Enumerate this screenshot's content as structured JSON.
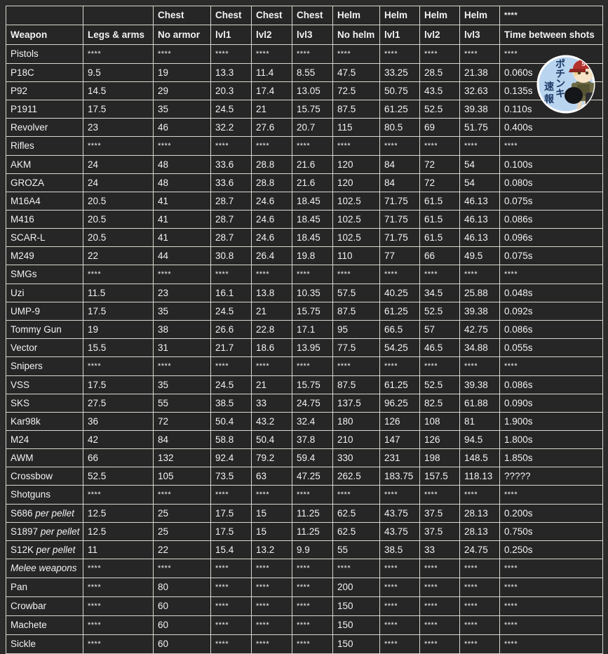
{
  "table": {
    "header_top": [
      "",
      "",
      "Chest",
      "Chest",
      "Chest",
      "Chest",
      "Helm",
      "Helm",
      "Helm",
      "Helm",
      "****"
    ],
    "header_main": [
      "Weapon",
      "Legs & arms",
      "No armor",
      "lvl1",
      "lvl2",
      "lvl3",
      "No helm",
      "lvl1",
      "lvl2",
      "lvl3",
      "Time between shots"
    ],
    "placeholder": "****",
    "rows": [
      {
        "type": "group",
        "style": "bold",
        "cells": [
          "Pistols",
          "****",
          "****",
          "****",
          "****",
          "****",
          "****",
          "****",
          "****",
          "****",
          "****"
        ]
      },
      {
        "type": "data",
        "cells": [
          "P18C",
          "9.5",
          "19",
          "13.3",
          "11.4",
          "8.55",
          "47.5",
          "33.25",
          "28.5",
          "21.38",
          "0.060s"
        ]
      },
      {
        "type": "data",
        "cells": [
          "P92",
          "14.5",
          "29",
          "20.3",
          "17.4",
          "13.05",
          "72.5",
          "50.75",
          "43.5",
          "32.63",
          "0.135s"
        ]
      },
      {
        "type": "data",
        "cells": [
          "P1911",
          "17.5",
          "35",
          "24.5",
          "21",
          "15.75",
          "87.5",
          "61.25",
          "52.5",
          "39.38",
          "0.110s"
        ]
      },
      {
        "type": "data",
        "cells": [
          "Revolver",
          "23",
          "46",
          "32.2",
          "27.6",
          "20.7",
          "115",
          "80.5",
          "69",
          "51.75",
          "0.400s"
        ]
      },
      {
        "type": "group",
        "style": "bold",
        "cells": [
          "Rifles",
          "****",
          "****",
          "****",
          "****",
          "****",
          "****",
          "****",
          "****",
          "****",
          "****"
        ]
      },
      {
        "type": "data",
        "cells": [
          "AKM",
          "24",
          "48",
          "33.6",
          "28.8",
          "21.6",
          "120",
          "84",
          "72",
          "54",
          "0.100s"
        ]
      },
      {
        "type": "data",
        "cells": [
          "GROZA",
          "24",
          "48",
          "33.6",
          "28.8",
          "21.6",
          "120",
          "84",
          "72",
          "54",
          "0.080s"
        ]
      },
      {
        "type": "data",
        "cells": [
          "M16A4",
          "20.5",
          "41",
          "28.7",
          "24.6",
          "18.45",
          "102.5",
          "71.75",
          "61.5",
          "46.13",
          "0.075s"
        ]
      },
      {
        "type": "data",
        "cells": [
          "M416",
          "20.5",
          "41",
          "28.7",
          "24.6",
          "18.45",
          "102.5",
          "71.75",
          "61.5",
          "46.13",
          "0.086s"
        ]
      },
      {
        "type": "data",
        "cells": [
          "SCAR-L",
          "20.5",
          "41",
          "28.7",
          "24.6",
          "18.45",
          "102.5",
          "71.75",
          "61.5",
          "46.13",
          "0.096s"
        ]
      },
      {
        "type": "data",
        "cells": [
          "M249",
          "22",
          "44",
          "30.8",
          "26.4",
          "19.8",
          "110",
          "77",
          "66",
          "49.5",
          "0.075s"
        ]
      },
      {
        "type": "group",
        "style": "bold",
        "cells": [
          "SMGs",
          "****",
          "****",
          "****",
          "****",
          "****",
          "****",
          "****",
          "****",
          "****",
          "****"
        ]
      },
      {
        "type": "data",
        "cells": [
          "Uzi",
          "11.5",
          "23",
          "16.1",
          "13.8",
          "10.35",
          "57.5",
          "40.25",
          "34.5",
          "25.88",
          "0.048s"
        ]
      },
      {
        "type": "data",
        "cells": [
          "UMP-9",
          "17.5",
          "35",
          "24.5",
          "21",
          "15.75",
          "87.5",
          "61.25",
          "52.5",
          "39.38",
          "0.092s"
        ]
      },
      {
        "type": "data",
        "cells": [
          "Tommy Gun",
          "19",
          "38",
          "26.6",
          "22.8",
          "17.1",
          "95",
          "66.5",
          "57",
          "42.75",
          "0.086s"
        ]
      },
      {
        "type": "data",
        "cells": [
          "Vector",
          "15.5",
          "31",
          "21.7",
          "18.6",
          "13.95",
          "77.5",
          "54.25",
          "46.5",
          "34.88",
          "0.055s"
        ]
      },
      {
        "type": "group",
        "style": "bold",
        "cells": [
          "Snipers",
          "****",
          "****",
          "****",
          "****",
          "****",
          "****",
          "****",
          "****",
          "****",
          "****"
        ]
      },
      {
        "type": "data",
        "cells": [
          "VSS",
          "17.5",
          "35",
          "24.5",
          "21",
          "15.75",
          "87.5",
          "61.25",
          "52.5",
          "39.38",
          "0.086s"
        ]
      },
      {
        "type": "data",
        "cells": [
          "SKS",
          "27.5",
          "55",
          "38.5",
          "33",
          "24.75",
          "137.5",
          "96.25",
          "82.5",
          "61.88",
          "0.090s"
        ]
      },
      {
        "type": "data",
        "cells": [
          "Kar98k",
          "36",
          "72",
          "50.4",
          "43.2",
          "32.4",
          "180",
          "126",
          "108",
          "81",
          "1.900s"
        ]
      },
      {
        "type": "data",
        "cells": [
          "M24",
          "42",
          "84",
          "58.8",
          "50.4",
          "37.8",
          "210",
          "147",
          "126",
          "94.5",
          "1.800s"
        ]
      },
      {
        "type": "data",
        "cells": [
          "AWM",
          "66",
          "132",
          "92.4",
          "79.2",
          "59.4",
          "330",
          "231",
          "198",
          "148.5",
          "1.850s"
        ]
      },
      {
        "type": "data",
        "cells": [
          "Crossbow",
          "52.5",
          "105",
          "73.5",
          "63",
          "47.25",
          "262.5",
          "183.75",
          "157.5",
          "118.13",
          "?????"
        ]
      },
      {
        "type": "group",
        "style": "bold",
        "cells": [
          "Shotguns",
          "****",
          "****",
          "****",
          "****",
          "****",
          "****",
          "****",
          "****",
          "****",
          "****"
        ]
      },
      {
        "type": "data",
        "name_main": "S686",
        "name_suffix": "per pellet",
        "cells": [
          "S686 per pellet",
          "12.5",
          "25",
          "17.5",
          "15",
          "11.25",
          "62.5",
          "43.75",
          "37.5",
          "28.13",
          "0.200s"
        ]
      },
      {
        "type": "data",
        "name_main": "S1897",
        "name_suffix": "per pellet",
        "cells": [
          "S1897 per pellet",
          "12.5",
          "25",
          "17.5",
          "15",
          "11.25",
          "62.5",
          "43.75",
          "37.5",
          "28.13",
          "0.750s"
        ]
      },
      {
        "type": "data",
        "name_main": "S12K",
        "name_suffix": "per pellet",
        "cells": [
          "S12K per pellet",
          "11",
          "22",
          "15.4",
          "13.2",
          "9.9",
          "55",
          "38.5",
          "33",
          "24.75",
          "0.250s"
        ]
      },
      {
        "type": "group",
        "style": "bold-italic",
        "cells": [
          "Melee weapons",
          "****",
          "****",
          "****",
          "****",
          "****",
          "****",
          "****",
          "****",
          "****",
          "****"
        ]
      },
      {
        "type": "data",
        "cells": [
          "Pan",
          "****",
          "80",
          "****",
          "****",
          "****",
          "200",
          "****",
          "****",
          "****",
          "****"
        ]
      },
      {
        "type": "data",
        "cells": [
          "Crowbar",
          "****",
          "60",
          "****",
          "****",
          "****",
          "150",
          "****",
          "****",
          "****",
          "****"
        ]
      },
      {
        "type": "data",
        "cells": [
          "Machete",
          "****",
          "60",
          "****",
          "****",
          "****",
          "150",
          "****",
          "****",
          "****",
          "****"
        ]
      },
      {
        "type": "data",
        "cells": [
          "Sickle",
          "****",
          "60",
          "****",
          "****",
          "****",
          "150",
          "****",
          "****",
          "****",
          "****"
        ]
      }
    ]
  },
  "watermark": {
    "name": "pochinki-sokuhou-logo",
    "text_vertical_right": "ポチンキ",
    "text_vertical_left": "速報",
    "cap_letter": "S",
    "circle_color": "#b9d4ef",
    "cap_color": "#b4312c"
  },
  "colors": {
    "background": "#2b2b2b",
    "cell_background": "#262626",
    "border": "#d8d8d0",
    "text": "#f2f2f2"
  }
}
